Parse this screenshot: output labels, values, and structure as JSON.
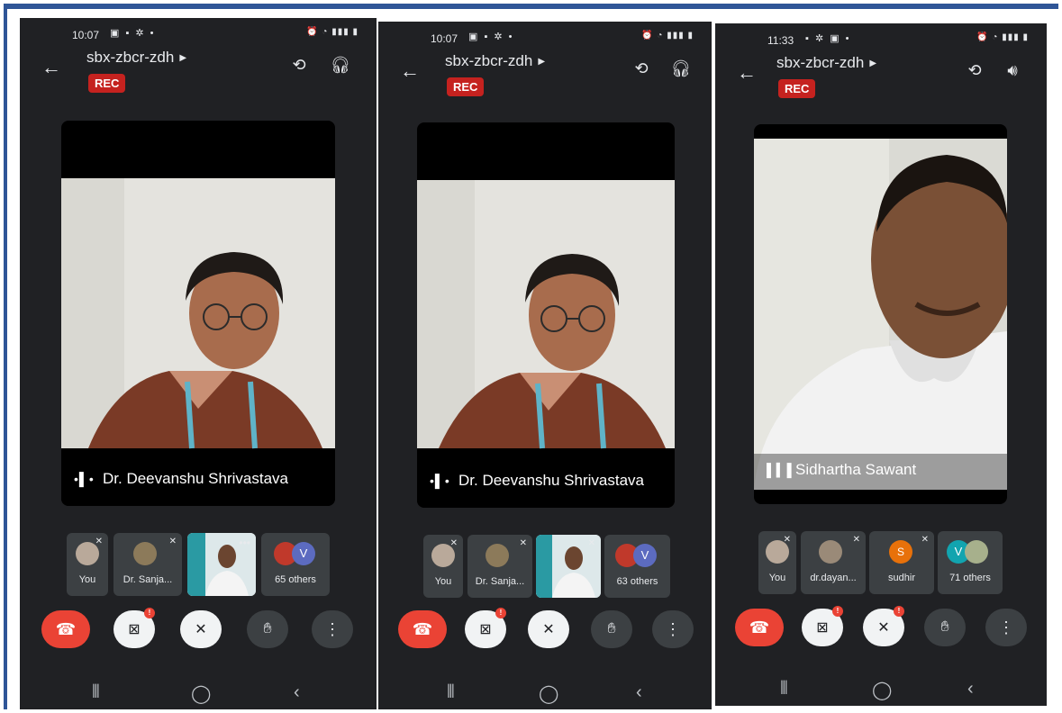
{
  "panels": [
    {
      "status_time": "10:07",
      "meeting_code": "sbx-zbcr-zdh",
      "rec_label": "REC",
      "header_icons": [
        "switch-camera-icon",
        "headphones-icon"
      ],
      "speaker_name": "Dr. Deevanshu Shrivastava",
      "tiles": [
        {
          "label": "You",
          "muted": true
        },
        {
          "label": "Dr. Sanja...",
          "muted": true
        },
        {
          "label": "",
          "muted": false
        },
        {
          "label": "65 others",
          "muted": false,
          "avatar_letter": "V"
        }
      ]
    },
    {
      "status_time": "10:07",
      "meeting_code": "sbx-zbcr-zdh",
      "rec_label": "REC",
      "header_icons": [
        "switch-camera-icon",
        "headphones-icon"
      ],
      "speaker_name": "Dr. Deevanshu Shrivastava",
      "tiles": [
        {
          "label": "You",
          "muted": true
        },
        {
          "label": "Dr. Sanja...",
          "muted": true
        },
        {
          "label": "",
          "muted": true
        },
        {
          "label": "63 others",
          "muted": false,
          "avatar_letter": "V"
        }
      ]
    },
    {
      "status_time": "11:33",
      "meeting_code": "sbx-zbcr-zdh",
      "rec_label": "REC",
      "header_icons": [
        "switch-camera-icon",
        "speaker-icon"
      ],
      "speaker_name": "Sidhartha Sawant",
      "tiles": [
        {
          "label": "You",
          "muted": true
        },
        {
          "label": "dr.dayan...",
          "muted": true
        },
        {
          "label": "sudhir",
          "muted": true,
          "avatar_letter": "S"
        },
        {
          "label": "71 others",
          "muted": false,
          "avatar_letter": "V"
        }
      ]
    }
  ],
  "control_icons": [
    "end-call-icon",
    "camera-off-icon",
    "mic-off-icon",
    "raise-hand-icon",
    "more-options-icon"
  ],
  "nav_icons": [
    "recent-apps-icon",
    "home-icon",
    "back-icon"
  ],
  "colors": {
    "rec": "#c5221f",
    "end_call": "#ea4335",
    "panel_bg": "#202124",
    "border": "#2f5597"
  }
}
